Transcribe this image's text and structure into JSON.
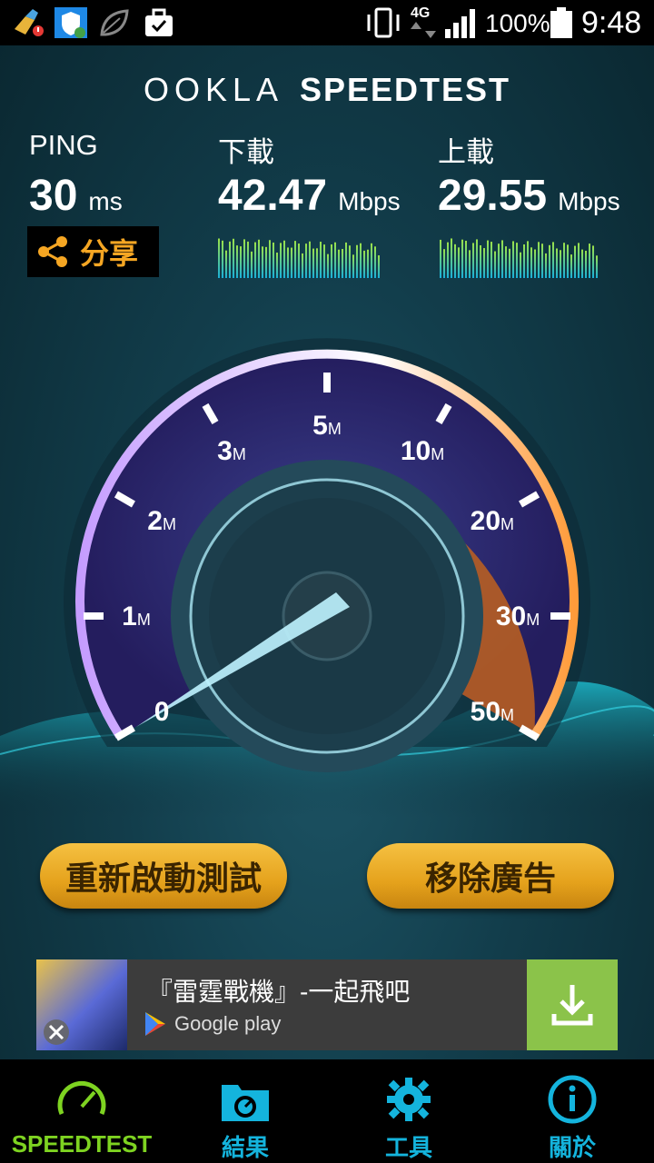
{
  "status_bar": {
    "battery": "100%",
    "time": "9:48",
    "network": "4G"
  },
  "header": {
    "brand": "OOKLA",
    "product": "SPEEDTEST"
  },
  "metrics": {
    "ping": {
      "label": "PING",
      "value": "30",
      "unit": "ms"
    },
    "download": {
      "label": "下載",
      "value": "42.47",
      "unit": "Mbps"
    },
    "upload": {
      "label": "上載",
      "value": "29.55",
      "unit": "Mbps"
    }
  },
  "share": {
    "label": "分享"
  },
  "gauge": {
    "ticks": [
      {
        "num": "0",
        "unit": ""
      },
      {
        "num": "1",
        "unit": "M"
      },
      {
        "num": "2",
        "unit": "M"
      },
      {
        "num": "3",
        "unit": "M"
      },
      {
        "num": "5",
        "unit": "M"
      },
      {
        "num": "10",
        "unit": "M"
      },
      {
        "num": "20",
        "unit": "M"
      },
      {
        "num": "30",
        "unit": "M"
      },
      {
        "num": "50",
        "unit": "M"
      }
    ]
  },
  "actions": {
    "restart_label": "重新啟動測試",
    "remove_ads_label": "移除廣告"
  },
  "ad": {
    "title": "『雷霆戰機』-一起飛吧",
    "store": "Google play"
  },
  "nav": {
    "items": [
      {
        "label": "SPEEDTEST",
        "icon": "speedometer-icon",
        "active": true
      },
      {
        "label": "結果",
        "icon": "folder-icon",
        "active": false
      },
      {
        "label": "工具",
        "icon": "gear-icon",
        "active": false
      },
      {
        "label": "關於",
        "icon": "info-icon",
        "active": false
      }
    ]
  },
  "colors": {
    "accent_green": "#7ed321",
    "accent_blue": "#14b4dd",
    "button_gold": "#e5a21c",
    "share_orange": "#f5a623"
  }
}
